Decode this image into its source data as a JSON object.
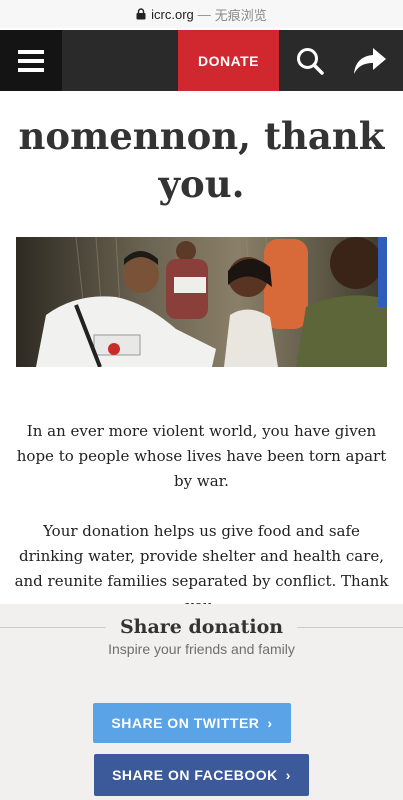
{
  "browser": {
    "domain": "icrc.org",
    "separator": "—",
    "mode_label": "无痕浏览"
  },
  "header": {
    "menu_icon": "hamburger-icon",
    "donate_label": "DONATE",
    "search_icon": "search-icon",
    "share_icon": "share-arrow-icon",
    "donate_color": "#d0282e"
  },
  "main": {
    "title": "nomennon, thank you.",
    "paragraphs": [
      "In an ever more violent world, you have given hope to people whose lives have been torn apart by war.",
      "Your donation helps us give food and safe drinking water, provide shelter and health care, and reunite families separated by conflict. Thank you."
    ]
  },
  "share": {
    "title": "Share donation",
    "subtitle": "Inspire your friends and family",
    "twitter_label": "SHARE ON TWITTER",
    "facebook_label": "SHARE ON FACEBOOK",
    "chevron": "›",
    "twitter_color": "#5aa3e6",
    "facebook_color": "#3c5a9a"
  }
}
